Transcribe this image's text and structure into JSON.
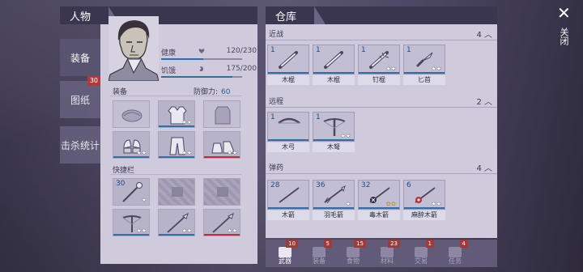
{
  "close": {
    "label": "关闭"
  },
  "character": {
    "title": "人物",
    "tabs": [
      {
        "label": "装备",
        "active": true
      },
      {
        "label": "图纸",
        "badge": "30"
      },
      {
        "label": "击杀统计"
      }
    ],
    "stats": [
      {
        "name": "健康",
        "value": "120/230",
        "fraction": 0.52
      },
      {
        "name": "饥饿",
        "value": "175/200",
        "fraction": 0.875
      }
    ],
    "equipment": {
      "label": "装备",
      "defense_label": "防御力:",
      "defense_value": "60"
    },
    "equip_slots": [
      {
        "icon": "hat-icon",
        "stars": ""
      },
      {
        "icon": "vest-icon",
        "stars": "★★"
      },
      {
        "icon": "jacket-icon",
        "stars": ""
      },
      {
        "icon": "gloves-icon",
        "stars": "★★"
      },
      {
        "icon": "pants-icon",
        "stars": "★★"
      },
      {
        "icon": "boots-icon",
        "stars": "★★"
      }
    ],
    "quickbar": {
      "label": "快捷栏"
    },
    "quick_slots": [
      {
        "icon": "flail-icon",
        "count": "30",
        "stars": "★"
      },
      {
        "icon": "locked-icon",
        "locked": true
      },
      {
        "icon": "locked-icon",
        "locked": true
      },
      {
        "icon": "crossbow-icon",
        "stars": "★★"
      },
      {
        "icon": "spear-icon",
        "stars": "★★"
      },
      {
        "icon": "spear-icon",
        "stars": "★★"
      }
    ]
  },
  "storage": {
    "title": "仓库",
    "categories": [
      {
        "name": "近战",
        "count": "4",
        "items": [
          {
            "name": "木棍",
            "count": "1",
            "stars": "",
            "icon": "club-icon"
          },
          {
            "name": "木棍",
            "count": "1",
            "stars": "",
            "icon": "club-icon"
          },
          {
            "name": "钉棍",
            "count": "1",
            "stars": "★★",
            "icon": "spiked-club-icon"
          },
          {
            "name": "匕首",
            "count": "1",
            "stars": "★★",
            "icon": "dagger-icon"
          }
        ]
      },
      {
        "name": "远程",
        "count": "2",
        "items": [
          {
            "name": "木弓",
            "count": "1",
            "stars": "",
            "icon": "bow-icon"
          },
          {
            "name": "木弩",
            "count": "1",
            "stars": "★★",
            "icon": "crossbow-icon"
          }
        ]
      },
      {
        "name": "弹药",
        "count": "4",
        "items": [
          {
            "name": "木箭",
            "count": "28",
            "stars": "",
            "icon": "arrow-icon"
          },
          {
            "name": "羽毛箭",
            "count": "36",
            "stars": "★",
            "icon": "feather-arrow-icon"
          },
          {
            "name": "毒木箭",
            "count": "32",
            "stars": "★★",
            "gold": true,
            "icon": "poison-arrow-icon"
          },
          {
            "name": "麻醉木箭",
            "count": "6",
            "stars": "★★",
            "icon": "tranquilizer-arrow-icon"
          }
        ]
      }
    ]
  },
  "bottom_tabs": [
    {
      "label": "武器",
      "count": "10",
      "active": true,
      "icon": "axe-icon"
    },
    {
      "label": "装备",
      "count": "5",
      "icon": "shirt-icon"
    },
    {
      "label": "食物",
      "count": "15",
      "icon": "food-icon"
    },
    {
      "label": "材料",
      "count": "23",
      "icon": "wood-icon"
    },
    {
      "label": "交易",
      "count": "1",
      "icon": "coin-icon"
    },
    {
      "label": "任务",
      "count": "4",
      "icon": "quest-icon"
    }
  ],
  "colors": {
    "accent_blue": "#2f6fa8",
    "badge_red": "#b23a3a",
    "star_gold": "#f2c230"
  }
}
